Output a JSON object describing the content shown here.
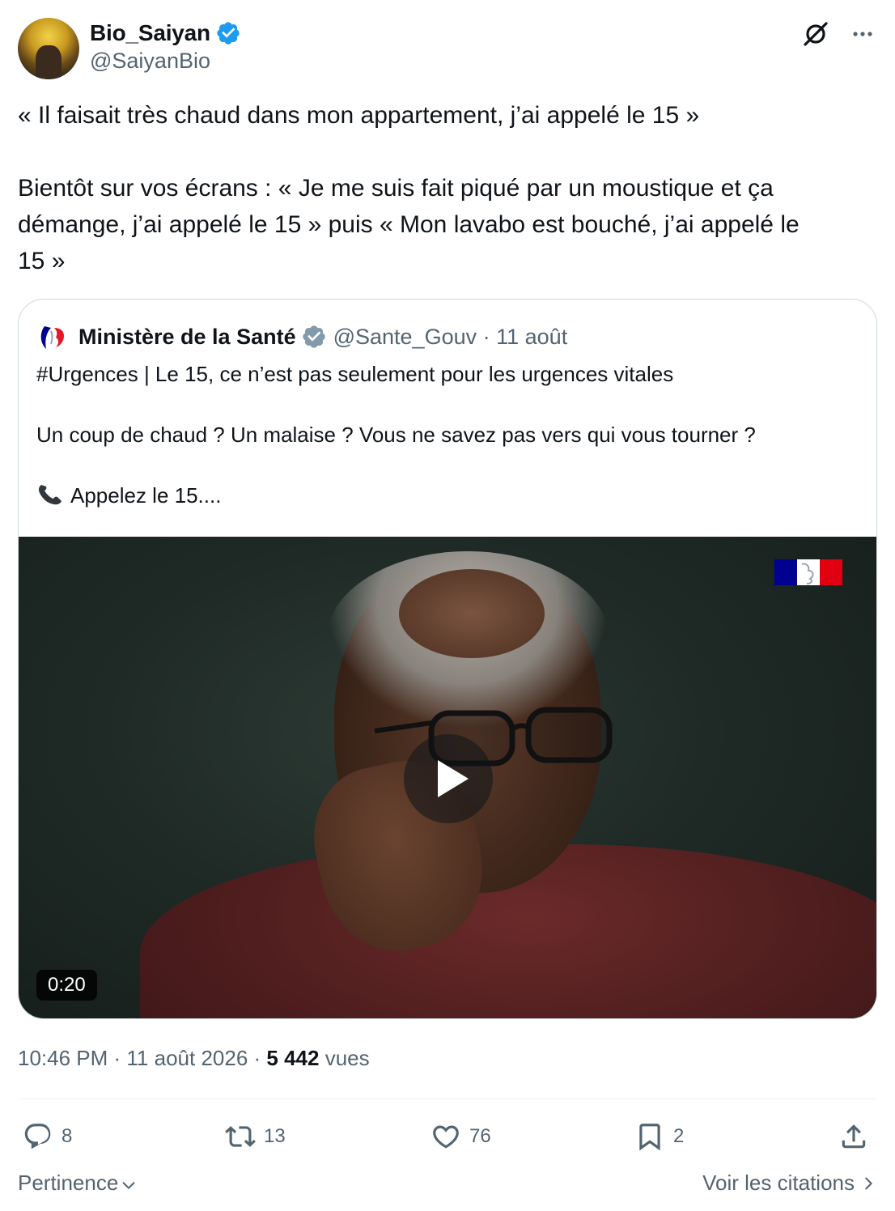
{
  "author": {
    "display_name": "Bio_Saiyan",
    "handle": "@SaiyanBio",
    "verified": true
  },
  "tweet": {
    "paragraphs": [
      "« Il faisait très chaud dans mon appartement, j’ai appelé le 15 »",
      "Bientôt sur vos écrans : « Je me suis fait piqué par un moustique et ça\ndémange, j’ai appelé le 15 » puis « Mon lavabo est bouché, j’ai appelé le\n15 »"
    ]
  },
  "quote": {
    "name": "Ministère de la Santé",
    "handle": "@Sante_Gouv",
    "separator": " · ",
    "date": "11 août",
    "verified_color": "#829aab",
    "lines": [
      "#Urgences | Le 15, ce n’est pas seulement pour les urgences vitales",
      "Un coup de chaud ? Un malaise ? Vous ne savez pas vers qui vous tourner ?",
      "Appelez le 15...."
    ],
    "video": {
      "duration": "0:20"
    }
  },
  "meta": {
    "time": "10:46 PM",
    "sep1": " · ",
    "date": "11 août 2026",
    "sep2": " · ",
    "views_count": "5 442",
    "views_label": " vues"
  },
  "actions": {
    "replies": "8",
    "reposts": "13",
    "likes": "76",
    "bookmarks": "2"
  },
  "footer": {
    "sort_label": "Pertinence",
    "quotes_label": "Voir les citations"
  },
  "colors": {
    "text_primary": "#0f1419",
    "text_secondary": "#536471",
    "verified_blue": "#1d9bf0",
    "border": "#cfd9de"
  },
  "icons": [
    "verified-badge-icon",
    "grok-icon",
    "more-icon",
    "play-icon",
    "phone-emoji-icon",
    "reply-icon",
    "repost-icon",
    "like-icon",
    "bookmark-icon",
    "share-icon",
    "chevron-down-icon",
    "chevron-right-icon"
  ]
}
